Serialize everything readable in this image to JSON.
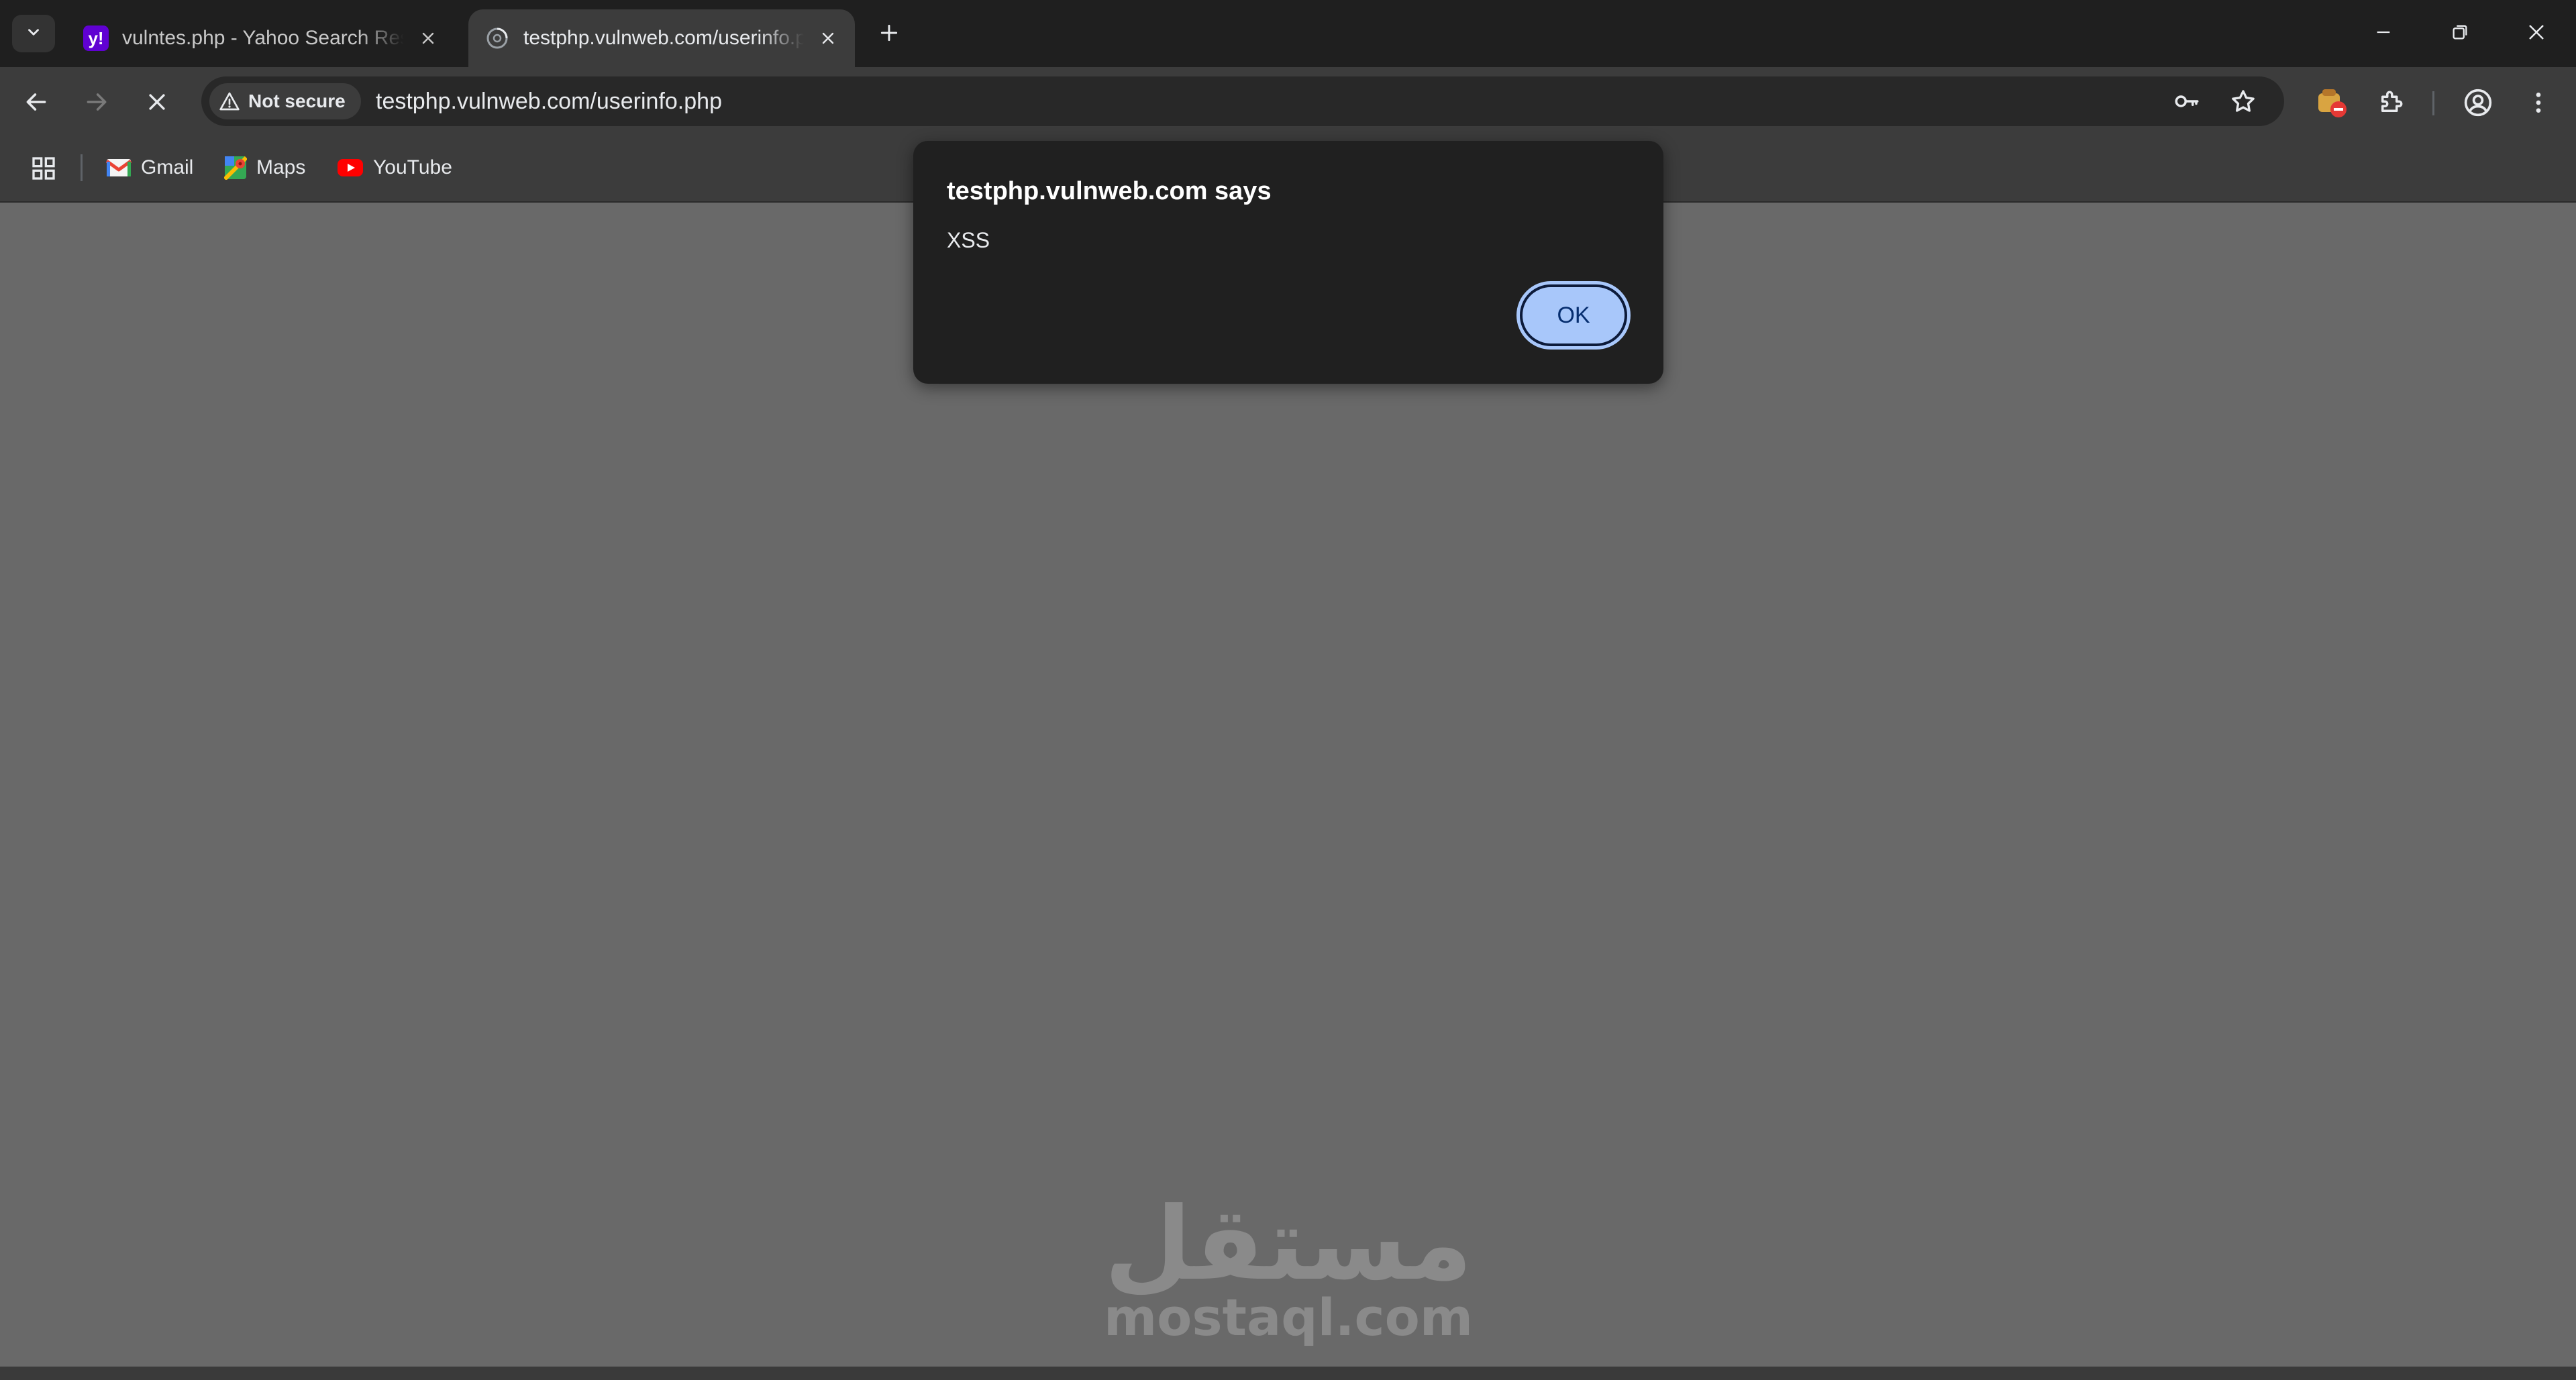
{
  "browser": {
    "tabs": [
      {
        "title": "vulntes.php - Yahoo Search Results",
        "favicon": "yahoo-icon",
        "active": false
      },
      {
        "title": "testphp.vulnweb.com/userinfo.php",
        "favicon": "loading-globe-icon",
        "active": true
      }
    ],
    "security_chip": "Not secure",
    "url": "testphp.vulnweb.com/userinfo.php",
    "bookmarks": [
      {
        "label": "Gmail",
        "icon": "gmail-icon"
      },
      {
        "label": "Maps",
        "icon": "maps-icon"
      },
      {
        "label": "YouTube",
        "icon": "youtube-icon"
      }
    ]
  },
  "dialog": {
    "title": "testphp.vulnweb.com says",
    "message": "XSS",
    "ok_label": "OK"
  },
  "watermark": {
    "arabic": "مستقل",
    "latin": "mostaql.com"
  },
  "colors": {
    "page_background": "#696969",
    "dialog_background": "#202020",
    "ok_button": "#a8c7fa",
    "chrome_dark": "#1f1f1f",
    "chrome_toolbar": "#3c3c3c"
  }
}
